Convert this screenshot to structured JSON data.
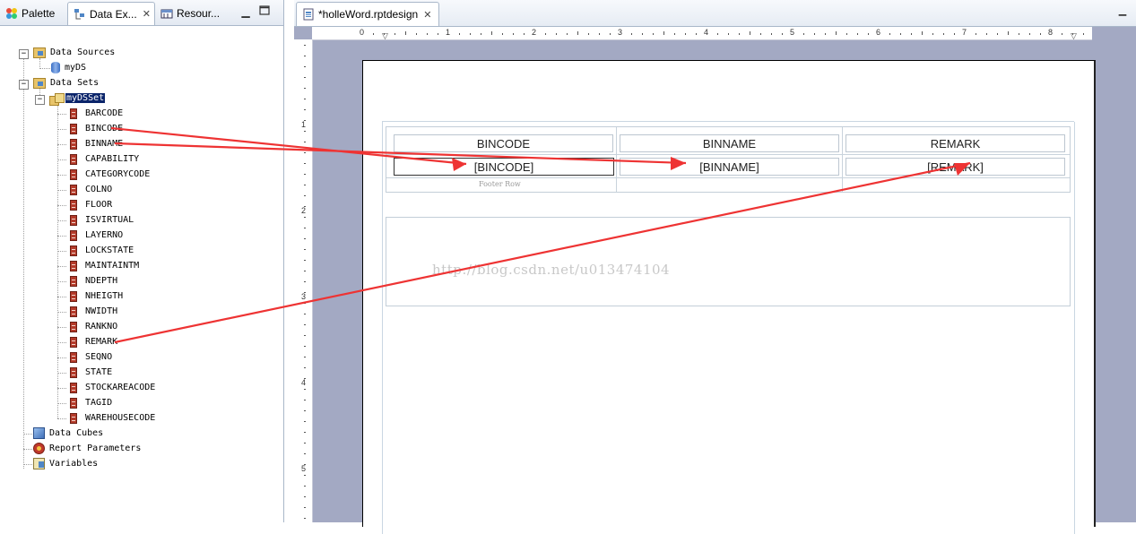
{
  "left_view": {
    "tabs": [
      {
        "label": "Palette",
        "icon": "palette-icon"
      },
      {
        "label": "Data Ex...",
        "icon": "data-explorer-icon",
        "active": true
      },
      {
        "label": "Resour...",
        "icon": "resource-explorer-icon"
      }
    ],
    "tree": {
      "data_sources": {
        "label": "Data Sources",
        "children": [
          "myDS"
        ]
      },
      "data_sets": {
        "label": "Data Sets",
        "dataset": {
          "label": "myDSSet",
          "selected": true,
          "columns": [
            "BARCODE",
            "BINCODE",
            "BINNAME",
            "CAPABILITY",
            "CATEGORYCODE",
            "COLNO",
            "FLOOR",
            "ISVIRTUAL",
            "LAYERNO",
            "LOCKSTATE",
            "MAINTAINTM",
            "NDEPTH",
            "NHEIGTH",
            "NWIDTH",
            "RANKNO",
            "REMARK",
            "SEQNO",
            "STATE",
            "STOCKAREACODE",
            "TAGID",
            "WAREHOUSECODE"
          ]
        }
      },
      "data_cubes": "Data Cubes",
      "report_parameters": "Report Parameters",
      "variables": "Variables"
    }
  },
  "editor": {
    "tab_title": "*holleWord.rptdesign",
    "ruler_h": [
      "0",
      "1",
      "2",
      "3",
      "4",
      "5",
      "6",
      "7",
      "8"
    ],
    "ruler_v": [
      "1",
      "2",
      "3",
      "4",
      "5"
    ],
    "table": {
      "header": [
        "BINCODE",
        "BINNAME",
        "REMARK"
      ],
      "detail": [
        "[BINCODE]",
        "[BINNAME]",
        "[REMARK]"
      ],
      "footer_label": "Footer Row"
    },
    "watermark": "http://blog.csdn.net/u013474104"
  },
  "colors": {
    "arrow": "#ee3333",
    "selection": "#0a246a",
    "canvas": "#a3a9c3"
  }
}
